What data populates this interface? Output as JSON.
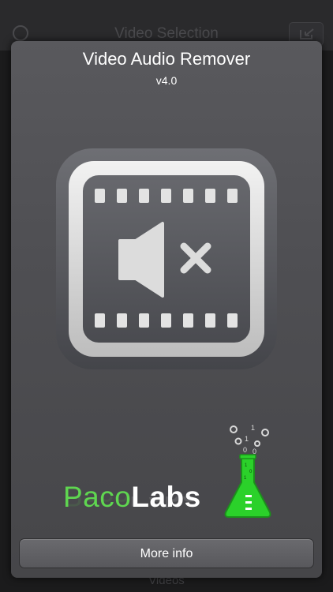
{
  "background_screen": {
    "nav_title": "Video Selection",
    "bottom_label": "Videos",
    "info_icon": "info-icon",
    "right_button_icon": "import-icon"
  },
  "about": {
    "title": "Video Audio Remover",
    "version": "v4.0",
    "app_icon": "film-strip-muted-speaker-icon",
    "brand": {
      "part1": "Paco",
      "part2": "Labs",
      "logo_icon": "flask-icon",
      "binary_glyphs": [
        "0",
        "0",
        "1",
        "0",
        "0",
        "1",
        "0"
      ]
    },
    "more_info_label": "More info"
  },
  "colors": {
    "brand_green": "#5fd650",
    "panel": "#545458",
    "text": "#ffffff"
  }
}
